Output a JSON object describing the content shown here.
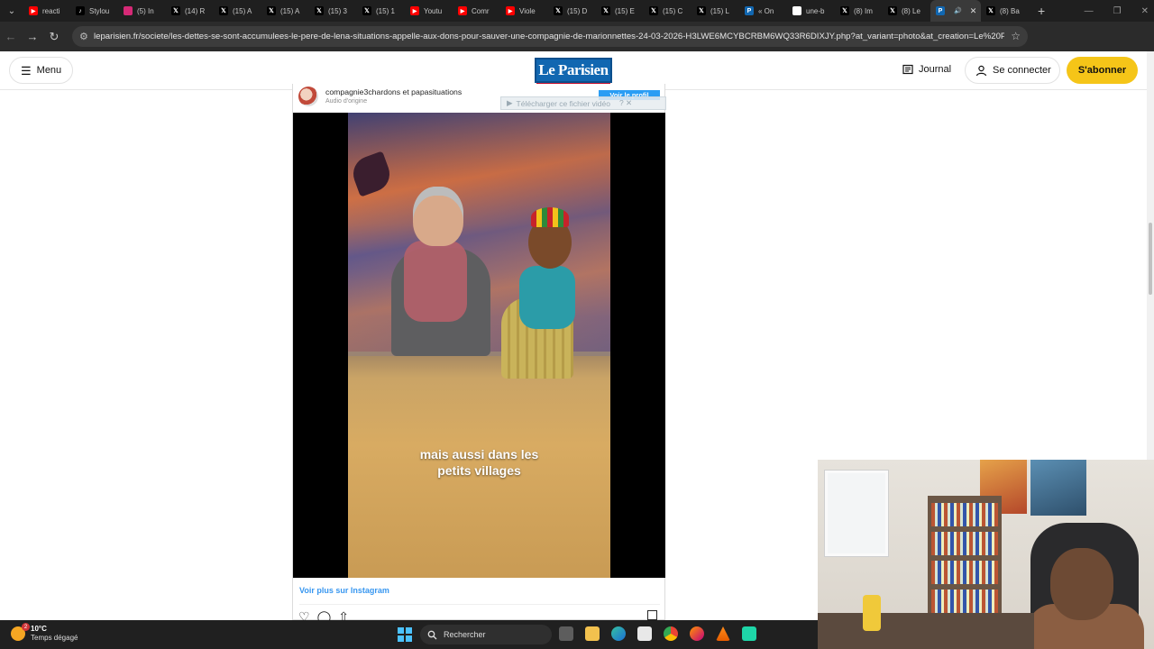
{
  "browser": {
    "tabs": [
      {
        "label": "reacti",
        "favicon": "youtube-icon",
        "color": "#ff0000"
      },
      {
        "label": "Stylou",
        "favicon": "tiktok-icon",
        "color": "#000000"
      },
      {
        "label": "(5) In",
        "favicon": "instagram-icon",
        "color": "#d62976"
      },
      {
        "label": "(14) R",
        "favicon": "x-icon",
        "color": "#000000"
      },
      {
        "label": "(15) A",
        "favicon": "x-icon",
        "color": "#000000"
      },
      {
        "label": "(15) A",
        "favicon": "x-icon",
        "color": "#000000"
      },
      {
        "label": "(15) 3",
        "favicon": "x-icon",
        "color": "#000000"
      },
      {
        "label": "(15) 1",
        "favicon": "x-icon",
        "color": "#000000"
      },
      {
        "label": "Youtu",
        "favicon": "youtube-icon",
        "color": "#ff0000"
      },
      {
        "label": "Comr",
        "favicon": "youtube-icon",
        "color": "#ff0000"
      },
      {
        "label": "Viole",
        "favicon": "youtube-icon",
        "color": "#ff0000"
      },
      {
        "label": "(15) D",
        "favicon": "x-icon",
        "color": "#000000"
      },
      {
        "label": "(15) E",
        "favicon": "x-icon",
        "color": "#000000"
      },
      {
        "label": "(15) C",
        "favicon": "x-icon",
        "color": "#000000"
      },
      {
        "label": "(15) L",
        "favicon": "x-icon",
        "color": "#000000"
      },
      {
        "label": "« On",
        "favicon": "leparisien-icon",
        "color": "#1167b1"
      },
      {
        "label": "une-b",
        "favicon": "page-icon",
        "color": "#ffffff"
      },
      {
        "label": "(8) Im",
        "favicon": "x-icon",
        "color": "#000000"
      },
      {
        "label": "(8) Le",
        "favicon": "x-icon",
        "color": "#000000"
      },
      {
        "label": "",
        "favicon": "leparisien-icon",
        "color": "#1167b1",
        "active": true
      },
      {
        "label": "(8) Ba",
        "favicon": "x-icon",
        "color": "#000000"
      }
    ],
    "url": "leparisien.fr/societe/les-dettes-se-sont-accumulees-le-pere-de-lena-situations-appelle-aux-dons-pour-sauver-une-compagnie-de-marionnettes-24-03-2026-H3LWE6MCYBCRBM6WQ33R6DIXJY.php?at_variant=photo&at_creation=Le%20Parisi..."
  },
  "site": {
    "menu_label": "Menu",
    "logo_text": "Le Parisien",
    "journal_label": "Journal",
    "connect_label": "Se connecter",
    "subscribe_label": "S'abonner",
    "accent": "#f5c518",
    "brand": "#1167b1"
  },
  "embed": {
    "account_1": "compagnie3chardons",
    "joiner": "et",
    "account_2": "papasituations",
    "audio_label": "Audio d'origine",
    "profile_button": "Voir le profil",
    "download_label": "Télécharger ce fichier vidéo",
    "caption": "mais aussi dans les\npetits villages",
    "view_more": "Voir plus sur Instagram"
  },
  "taskbar": {
    "temperature": "10°C",
    "weather": "Temps dégagé",
    "weather_badge": "2",
    "search_label": "Rechercher"
  }
}
